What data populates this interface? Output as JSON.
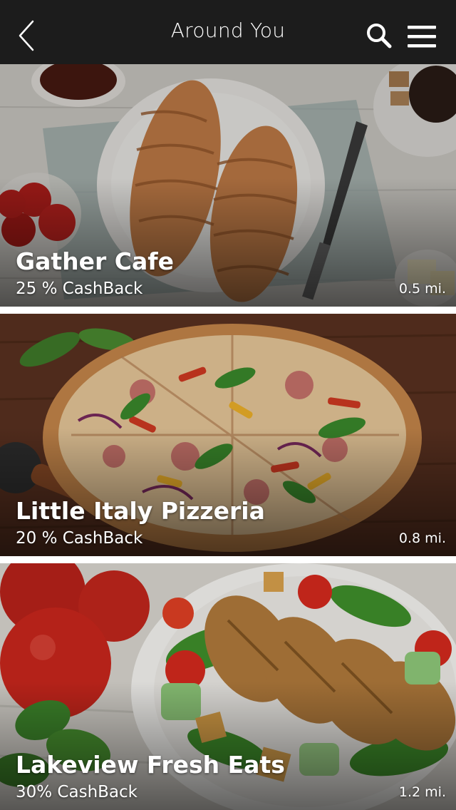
{
  "header": {
    "title": "Around You",
    "back_icon": "chevron-left-icon",
    "search_icon": "search-icon",
    "menu_icon": "hamburger-menu-icon"
  },
  "restaurants": [
    {
      "name": "Gather Cafe",
      "cashback": "25 % CashBack",
      "distance": "0.5 mi.",
      "image": "croissants-breakfast-photo"
    },
    {
      "name": "Little Italy Pizzeria",
      "cashback": "20 % CashBack",
      "distance": "0.8 mi.",
      "image": "pizza-photo"
    },
    {
      "name": "Lakeview Fresh Eats",
      "cashback": "30% CashBack",
      "distance": "1.2 mi.",
      "image": "chicken-salad-photo"
    }
  ]
}
